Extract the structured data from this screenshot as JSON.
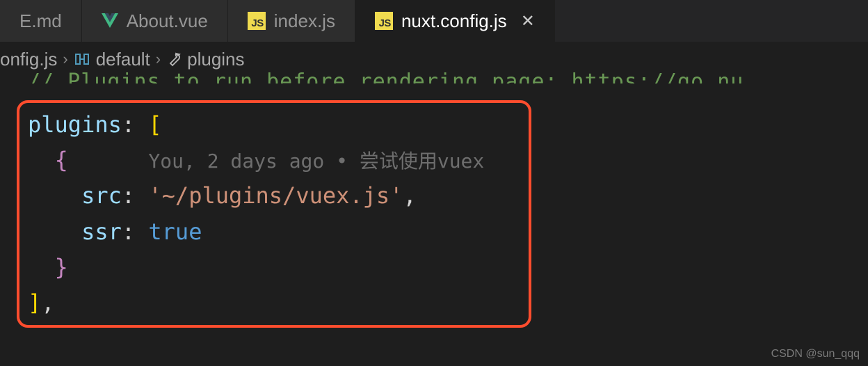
{
  "tabs": [
    {
      "label": "E.md",
      "type": "md"
    },
    {
      "label": "About.vue",
      "type": "vue"
    },
    {
      "label": "index.js",
      "type": "js"
    },
    {
      "label": "nuxt.config.js",
      "type": "js",
      "active": true,
      "closable": true
    }
  ],
  "breadcrumbs": {
    "file": "onfig.js",
    "symbol1": "default",
    "symbol2": "plugins"
  },
  "comment_line": {
    "prefix": "// Plugins to run before rendering page: ",
    "link": "https://go.nu"
  },
  "code": {
    "key_plugins": "plugins",
    "key_src": "src",
    "key_ssr": "ssr",
    "val_src": "'~/plugins/vuex.js'",
    "val_ssr": "true",
    "bracket_open": "[",
    "bracket_close": "]",
    "brace_open": "{",
    "brace_close": "}",
    "colon": ":",
    "comma": ","
  },
  "blame": {
    "author": "You",
    "age": "2 days ago",
    "sep": " • ",
    "msg": "尝试使用vuex"
  },
  "watermark": "CSDN @sun_qqq"
}
